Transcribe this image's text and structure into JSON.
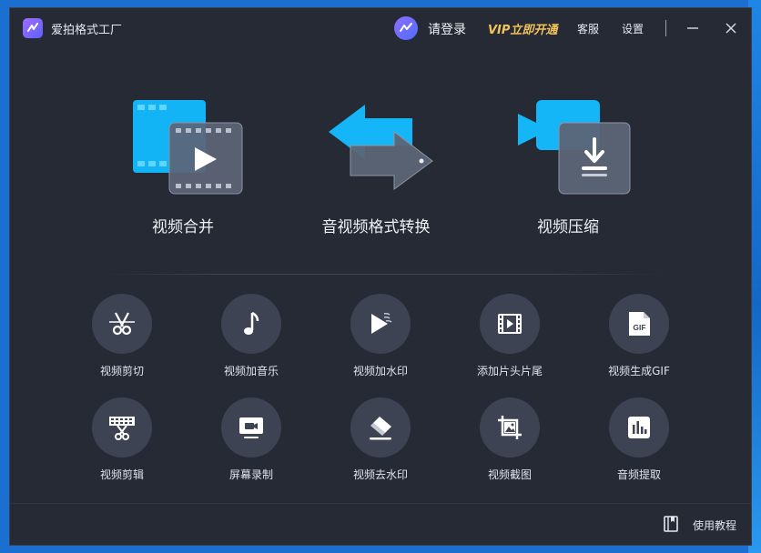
{
  "window": {
    "title": "爱拍格式工厂"
  },
  "header": {
    "login": "请登录",
    "vip": "VIP立即开通",
    "service": "客服",
    "settings": "设置"
  },
  "big_tools": [
    {
      "label": "视频合并",
      "icon": "video-merge-icon"
    },
    {
      "label": "音视频格式转换",
      "icon": "format-convert-icon"
    },
    {
      "label": "视频压缩",
      "icon": "video-compress-icon"
    }
  ],
  "small_tools": [
    {
      "label": "视频剪切",
      "icon": "scissors-icon"
    },
    {
      "label": "视频加音乐",
      "icon": "music-note-icon"
    },
    {
      "label": "视频加水印",
      "icon": "play-watermark-icon"
    },
    {
      "label": "添加片头片尾",
      "icon": "film-strip-icon"
    },
    {
      "label": "视频生成GIF",
      "icon": "gif-file-icon"
    },
    {
      "label": "视频剪辑",
      "icon": "film-scissors-icon"
    },
    {
      "label": "屏幕录制",
      "icon": "screen-record-icon"
    },
    {
      "label": "视频去水印",
      "icon": "eraser-icon"
    },
    {
      "label": "视频截图",
      "icon": "crop-image-icon"
    },
    {
      "label": "音频提取",
      "icon": "audio-wave-icon"
    }
  ],
  "footer": {
    "tutorial": "使用教程"
  },
  "colors": {
    "window_bg": "#252a35",
    "circle_bg": "#3d4352",
    "vip_accent": "#f3c25a",
    "brand_blue": "#19b8ff"
  }
}
